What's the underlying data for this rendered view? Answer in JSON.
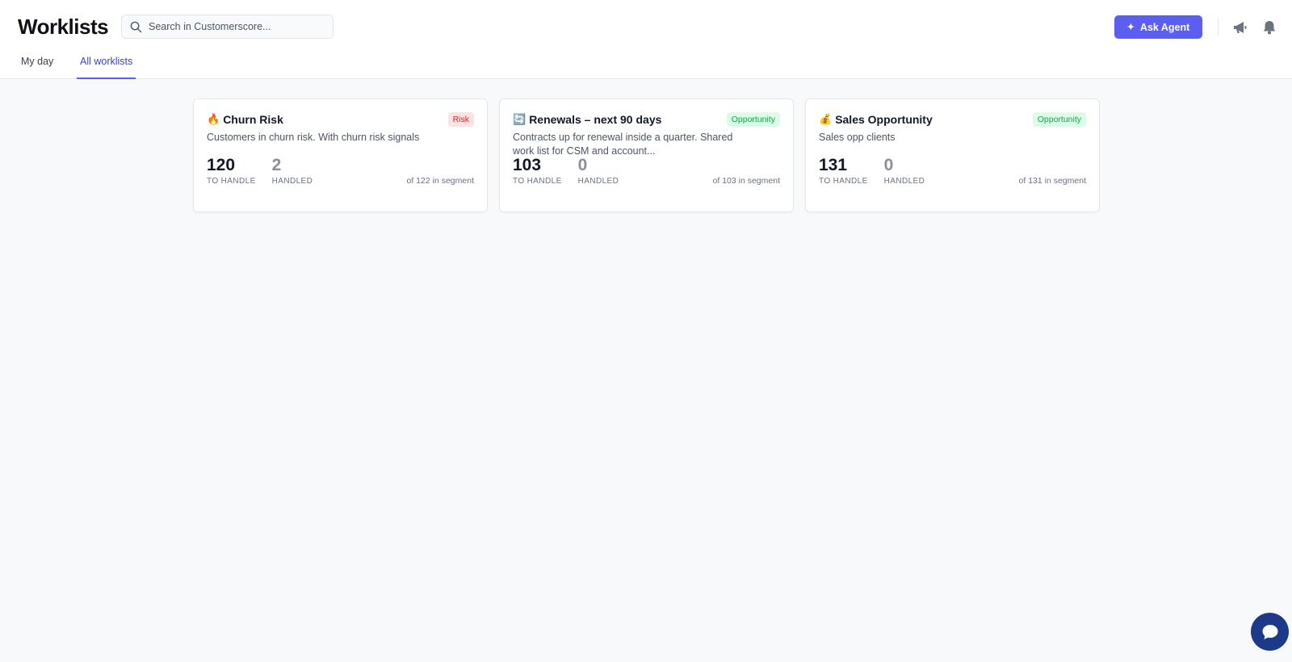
{
  "header": {
    "title": "Worklists",
    "search_placeholder": "Search in Customerscore...",
    "ask_agent_label": "Ask Agent",
    "accent_color": "#5b5ef0"
  },
  "tabs": [
    {
      "label": "My day",
      "active": false
    },
    {
      "label": "All worklists",
      "active": true
    }
  ],
  "worklists": [
    {
      "emoji": "🔥",
      "title": "Churn Risk",
      "badge": "Risk",
      "description": "Customers in churn risk. With churn risk signals",
      "to_handle": "120",
      "to_handle_label": "TO HANDLE",
      "handled": "2",
      "handled_label": "HANDLED",
      "segment": "of 122 in segment"
    },
    {
      "emoji": "🔄",
      "title": "Renewals – next 90 days",
      "badge": "Opportunity",
      "description": "Contracts up for renewal inside a quarter. Shared work list for CSM and account...",
      "to_handle": "103",
      "to_handle_label": "TO HANDLE",
      "handled": "0",
      "handled_label": "HANDLED",
      "segment": "of 103 in segment"
    },
    {
      "emoji": "💰",
      "title": "Sales Opportunity",
      "badge": "Opportunity",
      "description": "Sales opp clients",
      "to_handle": "131",
      "to_handle_label": "TO HANDLE",
      "handled": "0",
      "handled_label": "HANDLED",
      "segment": "of 131 in segment"
    }
  ],
  "icons": {
    "search": "search-icon",
    "announcements": "megaphone-icon",
    "notifications": "bell-icon",
    "chat": "chat-bubble-icon",
    "ask_agent": "sparkle-icon"
  }
}
